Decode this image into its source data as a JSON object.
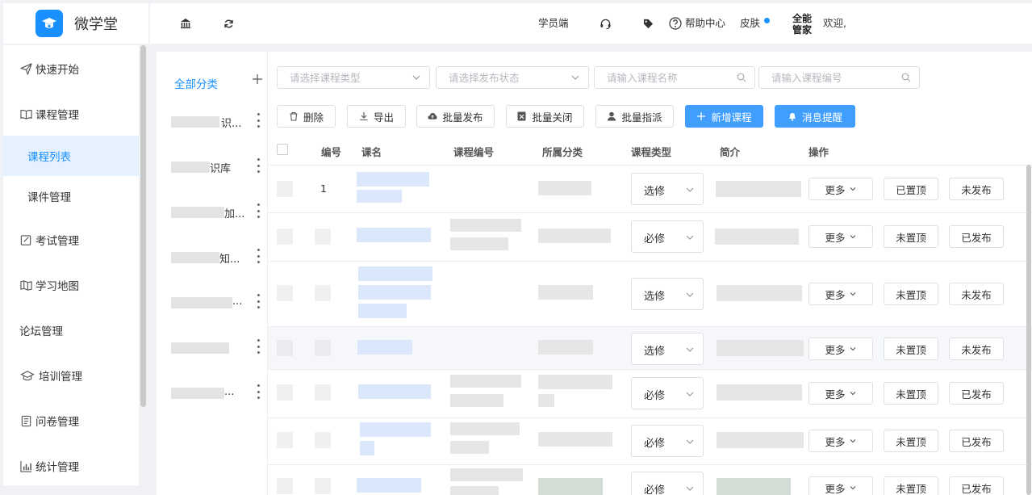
{
  "app": {
    "name": "微学堂"
  },
  "sidebar": {
    "items": [
      {
        "label": "快速开始",
        "icon": "paper-plane-icon"
      },
      {
        "label": "课程管理",
        "icon": "book-icon"
      },
      {
        "label": "课程列表",
        "icon": ""
      },
      {
        "label": "课件管理",
        "icon": ""
      },
      {
        "label": "考试管理",
        "icon": "edit-doc-icon"
      },
      {
        "label": "学习地图",
        "icon": "map-icon"
      },
      {
        "label": "论坛管理",
        "icon": ""
      },
      {
        "label": "培训管理",
        "icon": "graduation-cap-icon"
      },
      {
        "label": "问卷管理",
        "icon": "questionnaire-icon"
      },
      {
        "label": "统计管理",
        "icon": "bar-chart-icon"
      }
    ]
  },
  "header": {
    "student_side": "学员端",
    "help": "帮助中心",
    "skin": "皮肤",
    "user_name": "全能管家",
    "welcome": "欢迎,"
  },
  "categories": {
    "all_label": "全部分类",
    "items": [
      {
        "visible_text": "识..."
      },
      {
        "visible_text": "识库"
      },
      {
        "visible_text": "加..."
      },
      {
        "visible_text": "知..."
      },
      {
        "visible_text": "..."
      },
      {
        "visible_text": ""
      },
      {
        "visible_text": "..."
      }
    ]
  },
  "filters": {
    "course_type_placeholder": "请选择课程类型",
    "publish_status_placeholder": "请选择发布状态",
    "course_name_placeholder": "请输入课程名称",
    "course_code_placeholder": "请输入课程编号"
  },
  "toolbar": {
    "delete": "删除",
    "export": "导出",
    "batch_publish": "批量发布",
    "batch_close": "批量关闭",
    "batch_assign": "批量指派",
    "add_course": "新增课程",
    "message_reminder": "消息提醒"
  },
  "table": {
    "columns": [
      "编号",
      "课名",
      "课程编号",
      "所属分类",
      "课程类型",
      "简介",
      "操作"
    ],
    "more_label": "更多",
    "rows": [
      {
        "num": "1",
        "type": "选修",
        "pin": "已置顶",
        "publish": "未发布"
      },
      {
        "num": "",
        "type": "必修",
        "pin": "未置顶",
        "publish": "已发布"
      },
      {
        "num": "",
        "type": "选修",
        "pin": "未置顶",
        "publish": "未发布"
      },
      {
        "num": "",
        "type": "选修",
        "pin": "未置顶",
        "publish": "未发布"
      },
      {
        "num": "",
        "type": "必修",
        "pin": "未置顶",
        "publish": "已发布"
      },
      {
        "num": "",
        "type": "必修",
        "pin": "未置顶",
        "publish": "已发布"
      },
      {
        "num": "",
        "type": "必修",
        "pin": "未置顶",
        "publish": "已发布"
      }
    ]
  },
  "colors": {
    "primary": "#409eff",
    "active_menu_bg": "#e6f1ff",
    "skin_dot": "#1890ff"
  }
}
